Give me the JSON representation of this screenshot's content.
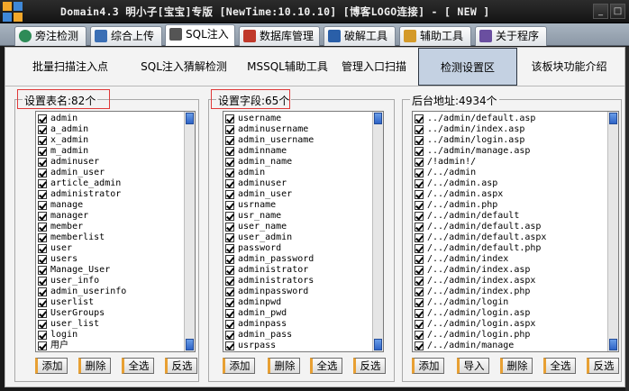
{
  "window": {
    "title": "Domain4.3 明小子[宝宝]专版 [NewTime:10.10.10] [博客LOGO连接]  - [ NEW ]",
    "min_label": "_",
    "max_label": "□"
  },
  "tabs": [
    {
      "label": "旁注检测",
      "icon": "globe-icon",
      "color": "#2e8b57"
    },
    {
      "label": "综合上传",
      "icon": "upload-icon",
      "color": "#3b6fb5"
    },
    {
      "label": "SQL注入",
      "icon": "syringe-icon",
      "color": "#555555"
    },
    {
      "label": "数据库管理",
      "icon": "database-icon",
      "color": "#c0392b"
    },
    {
      "label": "破解工具",
      "icon": "crack-icon",
      "color": "#2a5fa8"
    },
    {
      "label": "辅助工具",
      "icon": "clipboard-icon",
      "color": "#d49a2a"
    },
    {
      "label": "关于程序",
      "icon": "book-icon",
      "color": "#6a4fa0"
    }
  ],
  "subtabs": [
    {
      "label": "批量扫描注入点"
    },
    {
      "label": "SQL注入猜解检测"
    },
    {
      "label": "MSSQL辅助工具"
    },
    {
      "label": "管理入口扫描"
    },
    {
      "label": "检测设置区"
    },
    {
      "label": "该板块功能介绍"
    }
  ],
  "panels": {
    "tables": {
      "title": "设置表名:82个",
      "items": [
        "admin",
        "a_admin",
        "x_admin",
        "m_admin",
        "adminuser",
        "admin_user",
        "article_admin",
        "administrator",
        "manage",
        "manager",
        "member",
        "memberlist",
        "user",
        "users",
        "Manage_User",
        "user_info",
        "admin_userinfo",
        "userlist",
        "UserGroups",
        "user_list",
        "login",
        "用户"
      ],
      "buttons": [
        "添加",
        "删除",
        "全选",
        "反选"
      ]
    },
    "fields": {
      "title": "设置字段:65个",
      "items": [
        "username",
        "adminusername",
        "admin_username",
        "adminname",
        "admin_name",
        "admin",
        "adminuser",
        "admin_user",
        "usrname",
        "usr_name",
        "user_name",
        "user_admin",
        "password",
        "admin_password",
        "administrator",
        "administrators",
        "adminpassword",
        "adminpwd",
        "admin_pwd",
        "adminpass",
        "admin_pass",
        "usrpass"
      ],
      "buttons": [
        "添加",
        "删除",
        "全选",
        "反选"
      ]
    },
    "paths": {
      "title": "后台地址:4934个",
      "items": [
        "../admin/default.asp",
        "../admin/index.asp",
        "../admin/login.asp",
        "../admin/manage.asp",
        "/!admin!/",
        "/../admin",
        "/../admin.asp",
        "/../admin.aspx",
        "/../admin.php",
        "/../admin/default",
        "/../admin/default.asp",
        "/../admin/default.aspx",
        "/../admin/default.php",
        "/../admin/index",
        "/../admin/index.asp",
        "/../admin/index.aspx",
        "/../admin/index.php",
        "/../admin/login",
        "/../admin/login.asp",
        "/../admin/login.aspx",
        "/../admin/login.php",
        "/../admin/manage"
      ],
      "buttons": [
        "添加",
        "导入",
        "删除",
        "全选",
        "反选"
      ]
    }
  }
}
